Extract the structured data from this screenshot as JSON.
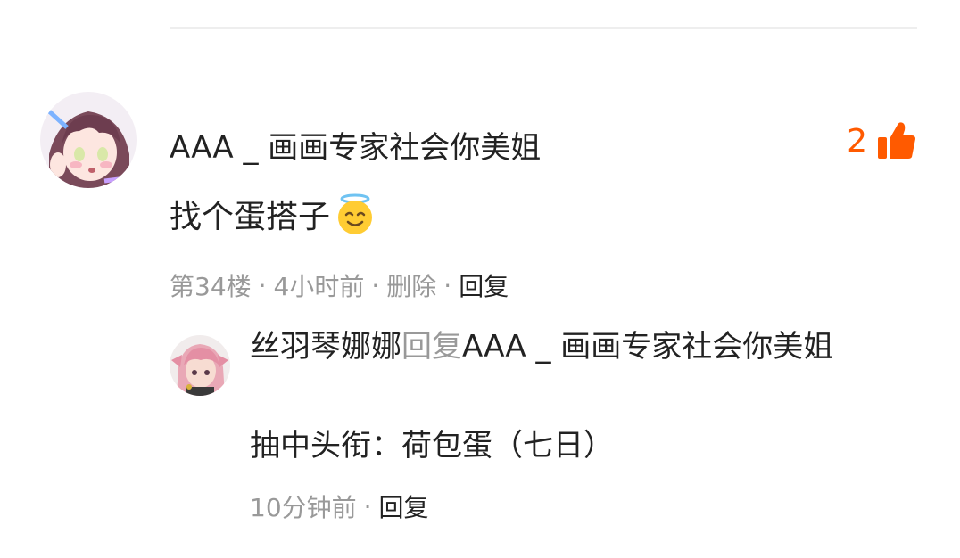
{
  "comment": {
    "username": "AAA _ 画画专家社会你美姐",
    "like_count": "2",
    "text": "找个蛋搭子",
    "floor": "第34楼",
    "time": "4小时前",
    "delete_label": "删除",
    "reply_label": "回复",
    "separator": "·"
  },
  "reply": {
    "author": "丝羽琴娜娜",
    "reply_word": "回复",
    "target": "AAA _ 画画专家社会你美姐",
    "text": "抽中头衔：荷包蛋（七日）",
    "time": "10分钟前",
    "reply_label": "回复",
    "separator": "·"
  },
  "colors": {
    "accent": "#ff5a00",
    "muted_text": "#999999",
    "primary_text": "#222222"
  },
  "icons": [
    "thumbs-up-icon",
    "smiling-halo-emoji"
  ]
}
